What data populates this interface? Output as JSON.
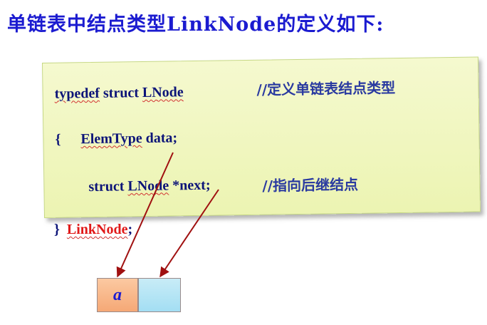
{
  "title": "单链表中结点类型LinkNode的定义如下:",
  "code": {
    "line1": {
      "kw1": "typedef",
      "kw2": " struct ",
      "name": "LNode",
      "comment": "//定义单链表结点类型"
    },
    "line2": {
      "brace": "{",
      "type": "ElemType",
      "field": " data;"
    },
    "line3": {
      "kw": "struct ",
      "type": "LNode",
      "field": " *next;",
      "comment": "//指向后继结点"
    },
    "closing": {
      "brace": "}",
      "name": "LinkNode",
      "semi": ";"
    }
  },
  "node": {
    "data_label": "a"
  },
  "colors": {
    "title": "#1b1bd0",
    "code": "#0c1478",
    "typename": "#e01818",
    "arrow": "#a01010",
    "box_fill": "#f0f6c0",
    "cell_data": "#f9b98a",
    "cell_next": "#b3e3f4"
  }
}
